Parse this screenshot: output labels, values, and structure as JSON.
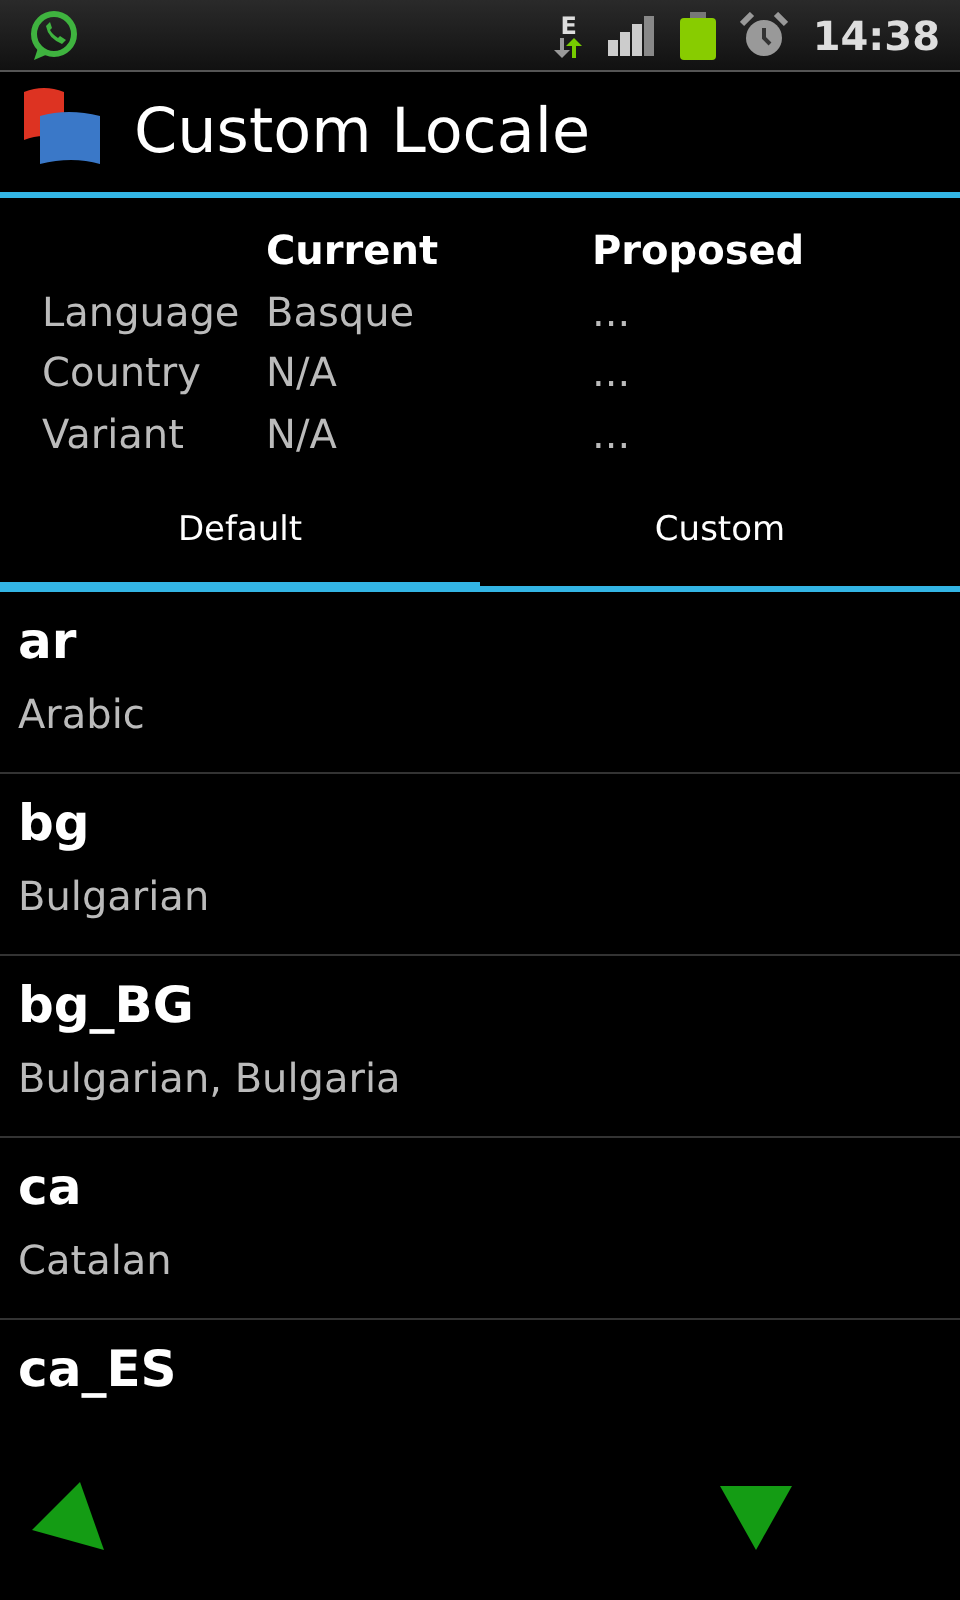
{
  "status_bar": {
    "time": "14:38",
    "network_label": "E"
  },
  "app_bar": {
    "title": "Custom Locale"
  },
  "locale_table": {
    "headers": [
      "Current",
      "Proposed"
    ],
    "rows": [
      {
        "label": "Language",
        "current": "Basque",
        "proposed": "..."
      },
      {
        "label": "Country",
        "current": "N/A",
        "proposed": "..."
      },
      {
        "label": "Variant",
        "current": "N/A",
        "proposed": "..."
      }
    ]
  },
  "tabs": [
    {
      "label": "Default",
      "selected": true
    },
    {
      "label": "Custom",
      "selected": false
    }
  ],
  "locales": [
    {
      "code": "ar",
      "name": "Arabic"
    },
    {
      "code": "bg",
      "name": "Bulgarian"
    },
    {
      "code": "bg_BG",
      "name": "Bulgarian, Bulgaria"
    },
    {
      "code": "ca",
      "name": "Catalan"
    },
    {
      "code": "ca_ES"
    }
  ]
}
